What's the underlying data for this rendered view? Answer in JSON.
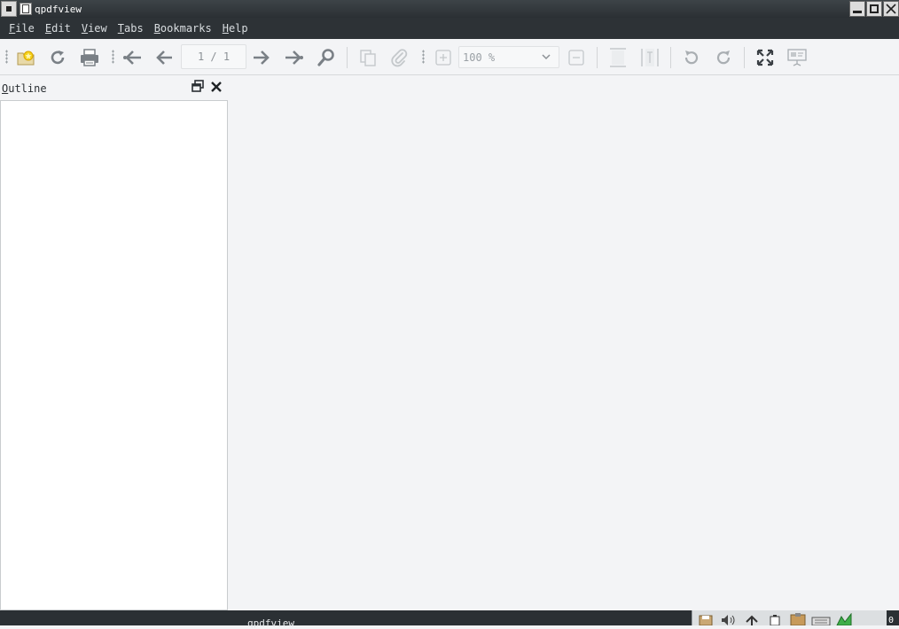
{
  "window": {
    "title": "qpdfview"
  },
  "menubar": {
    "items": [
      {
        "acc": "F",
        "rest": "ile"
      },
      {
        "acc": "E",
        "rest": "dit"
      },
      {
        "acc": "V",
        "rest": "iew"
      },
      {
        "acc": "T",
        "rest": "abs"
      },
      {
        "acc": "B",
        "rest": "ookmarks"
      },
      {
        "acc": "H",
        "rest": "elp"
      }
    ]
  },
  "toolbar": {
    "page_indicator": "1 / 1",
    "zoom_value": "100 %",
    "icons": {
      "open": "open-icon",
      "refresh": "refresh-icon",
      "print": "print-icon",
      "first_page": "first-page-icon",
      "previous_page": "previous-page-icon",
      "next_page": "next-page-icon",
      "last_page": "last-page-icon",
      "search": "search-icon",
      "copy": "copy-icon",
      "attachment": "attachment-icon",
      "zoom_in": "zoom-in-icon",
      "zoom_out": "zoom-out-icon",
      "fit_width": "fit-width-icon",
      "fit_page": "fit-page-icon",
      "rotate_left": "rotate-left-icon",
      "rotate_right": "rotate-right-icon",
      "fullscreen": "fullscreen-icon",
      "presentation": "presentation-icon"
    }
  },
  "outline": {
    "title_acc": "O",
    "title_rest": "utline"
  },
  "taskbar": {
    "task_label": "qpdfview",
    "clock_partial": "0"
  },
  "colors": {
    "titlebar": "#2b3034",
    "menubar": "#2d3236",
    "toolbar": "#f3f4f6",
    "panel": "#ffffff",
    "icon_gray": "#7a8086",
    "icon_disabled": "#c4c8cb"
  }
}
